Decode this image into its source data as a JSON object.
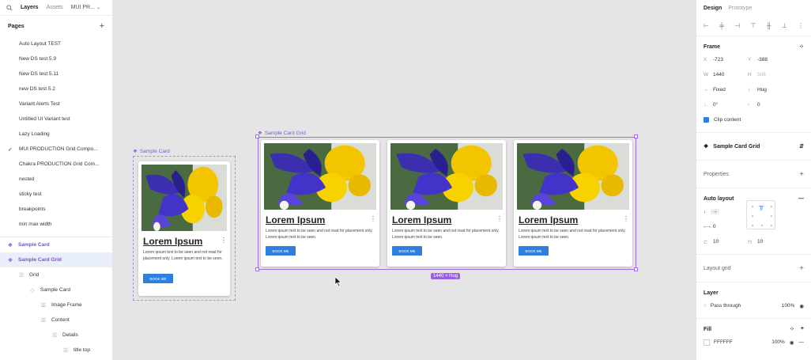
{
  "left": {
    "tabs": {
      "layers": "Layers",
      "assets": "Assets",
      "file": "MUI PR..."
    },
    "pages_label": "Pages",
    "pages": [
      "Auto Layout TEST",
      "New DS test 5.9",
      "New DS test 5.11",
      "new DS test 5.2",
      "Variant Alerts Test",
      "Untitled UI Variant test",
      "Lazy Loading",
      "MUI PRODUCTION Grid Compo...",
      "Chakra PRODUCTION Grid Com...",
      "nested",
      "sticky test",
      "breakpoints",
      "min max width"
    ],
    "layers": [
      {
        "label": "Sample Card",
        "indent": 0,
        "icon": "component-icon",
        "style": "purple"
      },
      {
        "label": "Sample Card Grid",
        "indent": 0,
        "icon": "component-icon",
        "style": "purple-sel"
      },
      {
        "label": "Grid",
        "indent": 1,
        "icon": "auto-layout-icon",
        "style": "normal"
      },
      {
        "label": "Sample Card",
        "indent": 2,
        "icon": "instance-icon",
        "style": "normal"
      },
      {
        "label": "Image Frame",
        "indent": 3,
        "icon": "auto-layout-icon",
        "style": "normal"
      },
      {
        "label": "Content",
        "indent": 3,
        "icon": "auto-layout-icon",
        "style": "normal"
      },
      {
        "label": "Details",
        "indent": 4,
        "icon": "auto-layout-icon",
        "style": "normal"
      },
      {
        "label": "title top",
        "indent": 5,
        "icon": "auto-layout-icon",
        "style": "normal"
      }
    ]
  },
  "canvas": {
    "single_label": "Sample Card",
    "grid_label": "Sample Card Grid",
    "size_badge": "1440 × Hug",
    "card": {
      "title": "Lorem Ipsum",
      "desc": "Lorem ipsum text to be seen and not read for placement only. Lorem ipsum text to be seen.",
      "button": "BOOK ME"
    }
  },
  "right": {
    "tabs": {
      "design": "Design",
      "prototype": "Prototype"
    },
    "frame": {
      "label": "Frame",
      "x": "-723",
      "y": "-388",
      "w": "1440",
      "h": "506",
      "w_mode": "Fixed",
      "h_mode": "Hug",
      "rotation": "0°",
      "radius": "0",
      "clip": "Clip content"
    },
    "component_name": "Sample Card Grid",
    "properties_label": "Properties",
    "auto_layout": {
      "label": "Auto layout",
      "spacing": "0",
      "pad_h": "10",
      "pad_v": "10"
    },
    "layout_grid_label": "Layout grid",
    "layer": {
      "label": "Layer",
      "blend": "Pass through",
      "opacity": "100%"
    },
    "fill": {
      "label": "Fill",
      "hex": "FFFFFF",
      "opacity": "100%"
    }
  },
  "colors": {
    "accent": "#9b5de5",
    "button": "#2f7fe0",
    "selection": "#e9eefb"
  }
}
